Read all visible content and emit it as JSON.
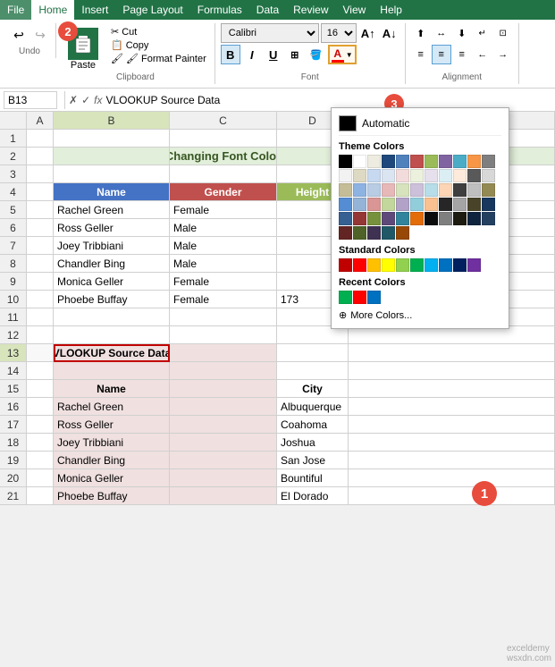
{
  "menuBar": {
    "items": [
      "File",
      "Home",
      "Insert",
      "Page Layout",
      "Formulas",
      "Data",
      "Review",
      "View",
      "Help"
    ]
  },
  "ribbonTabs": [
    "Home",
    "Insert",
    "Page Layout",
    "Formulas",
    "Data",
    "Review",
    "View",
    "Help"
  ],
  "activeTab": "Home",
  "clipboard": {
    "paste_label": "Paste",
    "cut_label": "✂ Cut",
    "copy_label": "📋 Copy",
    "format_painter_label": "🖌 Format Painter",
    "group_label": "Clipboard"
  },
  "font": {
    "font_name": "Calibri",
    "font_size": "16",
    "group_label": "Font",
    "bold": "B",
    "italic": "I",
    "underline": "U"
  },
  "alignment": {
    "group_label": "Alignment"
  },
  "formulaBar": {
    "cell_ref": "B13",
    "formula": "VLOOKUP Source Data",
    "fx": "fx"
  },
  "sheet": {
    "title": "Changing Font Color",
    "headers": [
      "",
      "A",
      "B",
      "C",
      "D"
    ],
    "tableHeaders": [
      "Name",
      "Gender",
      "Height"
    ],
    "rows": [
      {
        "id": 1,
        "cells": [
          "",
          "",
          "",
          ""
        ]
      },
      {
        "id": 2,
        "cells": [
          "",
          "Changing Font Color",
          "",
          ""
        ]
      },
      {
        "id": 3,
        "cells": [
          "",
          "",
          "",
          ""
        ]
      },
      {
        "id": 4,
        "cells": [
          "",
          "Name",
          "Gender",
          "Height"
        ]
      },
      {
        "id": 5,
        "cells": [
          "",
          "Rachel Green",
          "Female",
          ""
        ]
      },
      {
        "id": 6,
        "cells": [
          "",
          "Ross Geller",
          "Male",
          ""
        ]
      },
      {
        "id": 7,
        "cells": [
          "",
          "Joey Tribbiani",
          "Male",
          ""
        ]
      },
      {
        "id": 8,
        "cells": [
          "",
          "Chandler Bing",
          "Male",
          ""
        ]
      },
      {
        "id": 9,
        "cells": [
          "",
          "Monica Geller",
          "Female",
          ""
        ]
      },
      {
        "id": 10,
        "cells": [
          "",
          "Phoebe Buffay",
          "Female",
          "173"
        ]
      },
      {
        "id": 11,
        "cells": [
          "",
          "",
          "",
          ""
        ]
      },
      {
        "id": 12,
        "cells": [
          "",
          "",
          "",
          ""
        ]
      },
      {
        "id": 13,
        "cells": [
          "",
          "VLOOKUP Source Data",
          "",
          ""
        ]
      },
      {
        "id": 14,
        "cells": [
          "",
          "",
          "",
          ""
        ]
      },
      {
        "id": 15,
        "cells": [
          "",
          "Name",
          "",
          "City"
        ]
      },
      {
        "id": 16,
        "cells": [
          "",
          "Rachel Green",
          "",
          "Albuquerque"
        ]
      },
      {
        "id": 17,
        "cells": [
          "",
          "Ross Geller",
          "",
          "Coahoma"
        ]
      },
      {
        "id": 18,
        "cells": [
          "",
          "Joey Tribbiani",
          "",
          "Joshua"
        ]
      },
      {
        "id": 19,
        "cells": [
          "",
          "Chandler Bing",
          "",
          "San Jose"
        ]
      },
      {
        "id": 20,
        "cells": [
          "",
          "Monica Geller",
          "",
          "Bountiful"
        ]
      },
      {
        "id": 21,
        "cells": [
          "",
          "Phoebe Buffay",
          "",
          "El Dorado"
        ]
      }
    ]
  },
  "colorPicker": {
    "automatic_label": "Automatic",
    "theme_colors_label": "Theme Colors",
    "standard_colors_label": "Standard Colors",
    "recent_colors_label": "Recent Colors",
    "more_colors_label": "More Colors...",
    "themeColors": [
      "#000000",
      "#ffffff",
      "#eeece1",
      "#1f497d",
      "#4f81bd",
      "#c0504d",
      "#9bbb59",
      "#8064a2",
      "#4bacc6",
      "#f79646",
      "#7f7f7f",
      "#f2f2f2",
      "#ddd9c3",
      "#c6d9f0",
      "#dbe5f1",
      "#f2dcdb",
      "#ebf1dd",
      "#e5e0ec",
      "#dbeef3",
      "#fdeada",
      "#595959",
      "#d8d8d8",
      "#c4bd97",
      "#8db3e2",
      "#b8cce4",
      "#e6b8b7",
      "#d7e3bc",
      "#ccc0da",
      "#b7dde8",
      "#fbd5b5",
      "#3f3f3f",
      "#bfbfbf",
      "#938953",
      "#548dd4",
      "#95b3d7",
      "#d99694",
      "#c3d69b",
      "#b2a2c7",
      "#92cddc",
      "#fac08f",
      "#262626",
      "#a5a5a5",
      "#494429",
      "#17375e",
      "#366092",
      "#953734",
      "#76923c",
      "#5f497a",
      "#31849b",
      "#e36c09",
      "#0c0c0c",
      "#7f7f7f",
      "#1d1b10",
      "#0f243e",
      "#244061",
      "#632523",
      "#4f6228",
      "#3f3151",
      "#215868",
      "#974806"
    ],
    "standardColors": [
      "#c00000",
      "#ff0000",
      "#ffc000",
      "#ffff00",
      "#92d050",
      "#00b050",
      "#00b0f0",
      "#0070c0",
      "#002060",
      "#7030a0"
    ],
    "recentColors": [
      "#00b050",
      "#ff0000",
      "#0070c0"
    ]
  },
  "badges": {
    "b1": "1",
    "b2": "2",
    "b3": "3"
  },
  "extraCell": {
    "row10_d": "El Dorado"
  }
}
